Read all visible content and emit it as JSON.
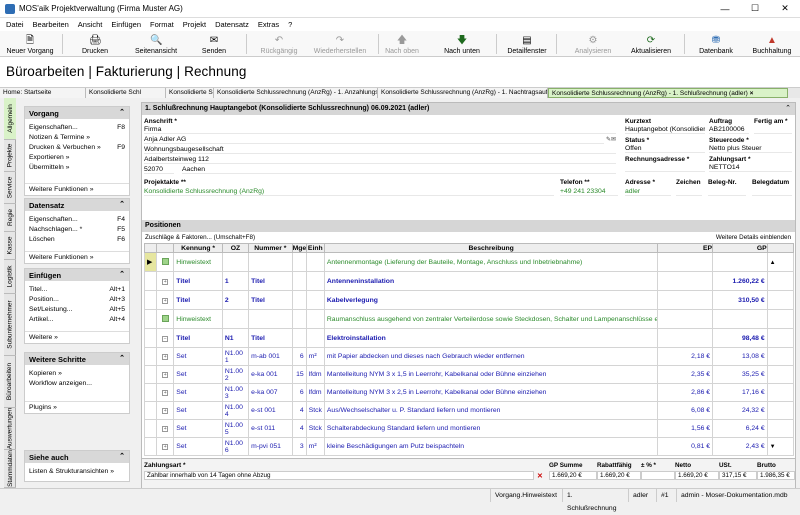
{
  "window": {
    "title": "MOS'aik Projektverwaltung (Firma Muster AG)"
  },
  "menu": [
    "Datei",
    "Bearbeiten",
    "Ansicht",
    "Einfügen",
    "Format",
    "Projekt",
    "Datensatz",
    "Extras",
    "?"
  ],
  "toolbar": [
    {
      "label": "Neuer Vorgang",
      "icon": "new-document-icon",
      "enabled": true
    },
    {
      "label": "Drucken",
      "icon": "printer-icon",
      "enabled": true
    },
    {
      "label": "Seitenansicht",
      "icon": "print-preview-icon",
      "enabled": true
    },
    {
      "label": "Senden",
      "icon": "send-mail-icon",
      "enabled": true
    },
    {
      "label": "Rückgängig",
      "icon": "undo-icon",
      "enabled": false
    },
    {
      "label": "Wiederherstellen",
      "icon": "redo-icon",
      "enabled": false
    },
    {
      "label": "Nach oben",
      "icon": "arrow-up-icon",
      "enabled": false
    },
    {
      "label": "Nach unten",
      "icon": "arrow-down-icon",
      "enabled": true
    },
    {
      "label": "Detailfenster",
      "icon": "detail-window-icon",
      "enabled": true
    },
    {
      "label": "Analysieren",
      "icon": "analyze-icon",
      "enabled": false
    },
    {
      "label": "Aktualisieren",
      "icon": "refresh-icon",
      "enabled": true
    },
    {
      "label": "Datenbank",
      "icon": "database-icon",
      "enabled": true
    },
    {
      "label": "Buchhaltung",
      "icon": "accounting-icon",
      "enabled": true
    }
  ],
  "header": {
    "title": "Büroarbeiten | Fakturierung | Rechnung"
  },
  "tabs": [
    "Home: Startseite",
    "Konsolidierte Schl",
    "Konsolidierte Schlu",
    "Konsolidierte Schlussrechnung (AnzRg) - 1. Anzahlungsr",
    "Konsolidierte Schlussrechnung (AnzRg) - 1. Nachtragsauftrag",
    "Konsolidierte Schlussrechnung (AnzRg) - 1. Schlußrechnung (adler)"
  ],
  "vtabs": [
    "Allgemein",
    "Projekte",
    "Service",
    "Regie",
    "Kasse",
    "Logistik",
    "Subunternehmer",
    "Büroarbeiten",
    "Auswertungen",
    "Stammdaten"
  ],
  "sidebar": {
    "vorgang": {
      "title": "Vorgang",
      "items": [
        {
          "label": "Eigenschaften...",
          "key": "F8"
        },
        {
          "label": "Notizen & Termine »",
          "key": ""
        },
        {
          "label": "Drucken & Verbuchen »",
          "key": "F9"
        },
        {
          "label": "Exportieren »",
          "key": ""
        },
        {
          "label": "Übermitteln »",
          "key": ""
        }
      ],
      "more": "Weitere Funktionen »"
    },
    "datensatz": {
      "title": "Datensatz",
      "items": [
        {
          "label": "Eigenschaften...",
          "key": "F4"
        },
        {
          "label": "Nachschlagen... *",
          "key": "F5"
        },
        {
          "label": "Löschen",
          "key": "F6"
        }
      ],
      "more": "Weitere Funktionen »"
    },
    "einfuegen": {
      "title": "Einfügen",
      "items": [
        {
          "label": "Titel...",
          "key": "Alt+1"
        },
        {
          "label": "Position...",
          "key": "Alt+3"
        },
        {
          "label": "Set/Leistung...",
          "key": "Alt+5"
        },
        {
          "label": "Artikel...",
          "key": "Alt+4"
        }
      ],
      "more": "Weitere »"
    },
    "schritte": {
      "title": "Weitere Schritte",
      "items": [
        {
          "label": "Kopieren »",
          "key": ""
        },
        {
          "label": "Workflow anzeigen...",
          "key": ""
        }
      ],
      "more": "Plugins »"
    },
    "siehe": {
      "title": "Siehe auch",
      "more": "Listen & Strukturansichten »"
    }
  },
  "document": {
    "title": "1. Schlußrechnung Hauptangebot (Konsolidierte Schlussrechnung) 06.09.2021 (adler)",
    "anschrift_label": "Anschrift *",
    "anschrift": [
      "Firma",
      "Anja Adler AG",
      "Wohnungsbaugesellschaft",
      "Adalbertsteinweg 112",
      "52070",
      "Aachen"
    ],
    "kurztext_label": "Kurztext",
    "kurztext": "Hauptangebot (Konsolidier",
    "auftrag_label": "Auftrag",
    "auftrag": "AB2100006",
    "fertig_label": "Fertig am *",
    "status_label": "Status *",
    "status": "Offen",
    "steuercode_label": "Steuercode *",
    "steuercode": "Netto plus Steuer",
    "rechadr_label": "Rechnungsadresse *",
    "zahlungsart_label": "Zahlungsart *",
    "zahlungsart": "NETTO14",
    "projektakte_label": "Projektakte **",
    "projektakte": "Konsolidierte Schlussrechnung (AnzRg)",
    "telefon_label": "Telefon **",
    "telefon": "+49 241 23304",
    "adresse_label": "Adresse *",
    "adresse": "adler",
    "zeichen_label": "Zeichen",
    "belegnr_label": "Beleg-Nr.",
    "belegdatum_label": "Belegdatum"
  },
  "positionen": {
    "title": "Positionen",
    "zuschlaege": "Zuschläge & Faktoren... (Umschalt+F8)",
    "details": "Weitere Details einblenden",
    "columns": [
      "Kennung *",
      "OZ",
      "Nummer *",
      "Mge",
      "Einh",
      "Beschreibung",
      "EP",
      "GP"
    ],
    "rows": [
      {
        "kennung": "Hinweistext",
        "oz": "",
        "nummer": "",
        "mge": "",
        "einh": "",
        "beschreibung": "Antennenmontage (Lieferung der Bauteile, Montage, Anschluss und Inbetriebnahme)",
        "ep": "",
        "gp": "",
        "kind": "hinweis"
      },
      {
        "kennung": "Titel",
        "oz": "1",
        "nummer": "Titel",
        "mge": "",
        "einh": "",
        "beschreibung": "Antenneninstallation",
        "ep": "",
        "gp": "1.260,22 €",
        "kind": "titel"
      },
      {
        "kennung": "Titel",
        "oz": "2",
        "nummer": "Titel",
        "mge": "",
        "einh": "",
        "beschreibung": "Kabelverlegung",
        "ep": "",
        "gp": "310,50 €",
        "kind": "titel"
      },
      {
        "kennung": "Hinweistext",
        "oz": "",
        "nummer": "",
        "mge": "",
        "einh": "",
        "beschreibung": "Raumanschluss ausgehend von zentraler Verteilerdose sowie Steckdosen, Schalter und Lampenanschlüsse erneuern",
        "ep": "",
        "gp": "",
        "kind": "hinweis"
      },
      {
        "kennung": "Titel",
        "oz": "N1",
        "nummer": "Titel",
        "mge": "",
        "einh": "",
        "beschreibung": "Elektroinstallation",
        "ep": "",
        "gp": "98,48 €",
        "kind": "titel"
      },
      {
        "kennung": "Set",
        "oz": "N1.00 1",
        "nummer": "m-ab 001",
        "mge": "6",
        "einh": "m²",
        "beschreibung": "mit Papier abdecken und dieses nach Gebrauch wieder entfernen",
        "ep": "2,18 €",
        "gp": "13,08 €",
        "kind": "set"
      },
      {
        "kennung": "Set",
        "oz": "N1.00 2",
        "nummer": "e-ka 001",
        "mge": "15",
        "einh": "lfdm",
        "beschreibung": "Mantelleitung NYM 3 x 1,5 in Leerrohr, Kabelkanal oder Bühne einziehen",
        "ep": "2,35 €",
        "gp": "35,25 €",
        "kind": "set"
      },
      {
        "kennung": "Set",
        "oz": "N1.00 3",
        "nummer": "e-ka 007",
        "mge": "6",
        "einh": "lfdm",
        "beschreibung": "Mantelleitung NYM 3 x 2,5 in Leerrohr, Kabelkanal oder Bühne einziehen",
        "ep": "2,86 €",
        "gp": "17,16 €",
        "kind": "set"
      },
      {
        "kennung": "Set",
        "oz": "N1.00 4",
        "nummer": "e-st 001",
        "mge": "4",
        "einh": "Stck",
        "beschreibung": "Aus/Wechselschalter u. P. Standard liefern und montieren",
        "ep": "6,08 €",
        "gp": "24,32 €",
        "kind": "set"
      },
      {
        "kennung": "Set",
        "oz": "N1.00 5",
        "nummer": "e-st 011",
        "mge": "4",
        "einh": "Stck",
        "beschreibung": "Schalterabdeckung Standard liefern und montieren",
        "ep": "1,56 €",
        "gp": "6,24 €",
        "kind": "set"
      },
      {
        "kennung": "Set",
        "oz": "N1.00 6",
        "nummer": "m-pvi 051",
        "mge": "3",
        "einh": "m²",
        "beschreibung": "kleine Beschädigungen am Putz beispachteln",
        "ep": "0,81 €",
        "gp": "2,43 €",
        "kind": "set"
      }
    ]
  },
  "footer": {
    "zahlungsart_label": "Zahlungsart *",
    "zahlungsart_text": "Zahlbar innerhalb von 14 Tagen ohne Abzug",
    "cols": [
      {
        "label": "GP Summe",
        "value": "1.669,20 €"
      },
      {
        "label": "Rabattfähig",
        "value": "1.669,20 €"
      },
      {
        "label": "± % *",
        "value": ""
      },
      {
        "label": "Netto",
        "value": "1.669,20 €"
      },
      {
        "label": "USt.",
        "value": "317,15 €"
      },
      {
        "label": "Brutto",
        "value": "1.986,35 €"
      }
    ]
  },
  "statusbar": [
    "Vorgang.Hinweistext",
    "1. Schlußrechnung",
    "adler",
    "#1",
    "admin - Moser-Dokumentation.mdb"
  ]
}
